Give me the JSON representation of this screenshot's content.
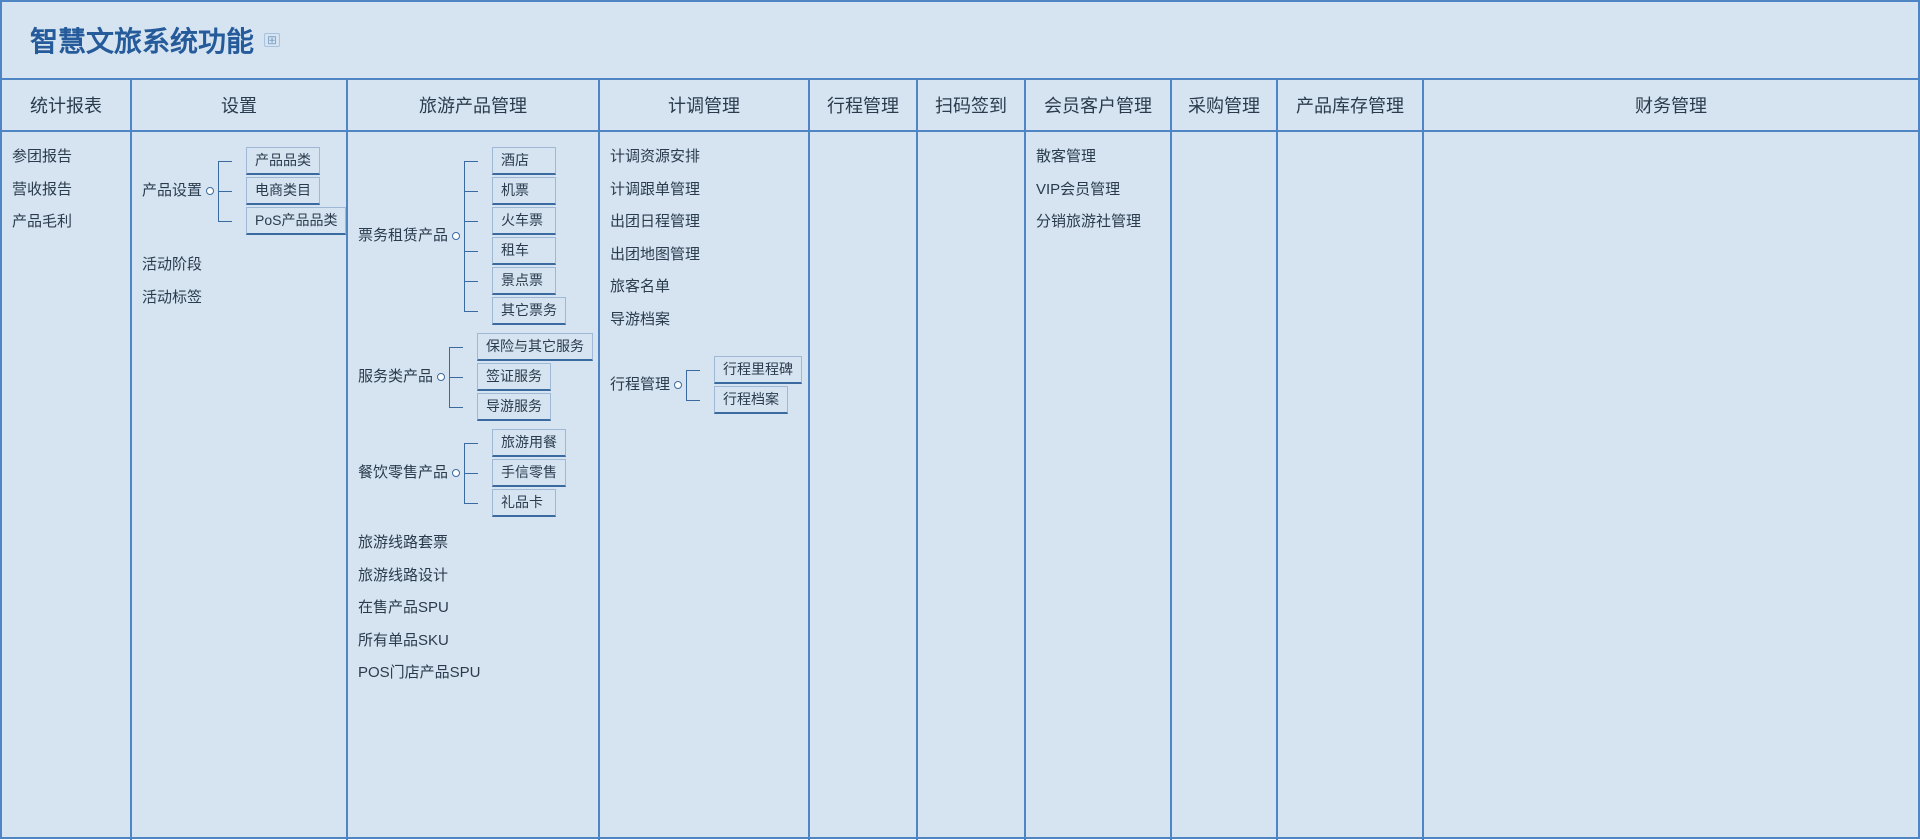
{
  "title": "智慧文旅系统功能",
  "columns": {
    "stats": {
      "header": "统计报表",
      "items": [
        "参团报告",
        "营收报告",
        "产品毛利"
      ]
    },
    "settings": {
      "header": "设置",
      "product_settings_label": "产品设置",
      "product_settings_children": [
        "产品品类",
        "电商类目",
        "PoS产品品类"
      ],
      "extra": [
        "活动阶段",
        "活动标签"
      ]
    },
    "products": {
      "header": "旅游产品管理",
      "groups": [
        {
          "label": "票务租赁产品",
          "children": [
            "酒店",
            "机票",
            "火车票",
            "租车",
            "景点票",
            "其它票务"
          ]
        },
        {
          "label": "服务类产品",
          "children": [
            "保险与其它服务",
            "签证服务",
            "导游服务"
          ]
        },
        {
          "label": "餐饮零售产品",
          "children": [
            "旅游用餐",
            "手信零售",
            "礼品卡"
          ]
        }
      ],
      "flat": [
        "旅游线路套票",
        "旅游线路设计",
        "在售产品SPU",
        "所有单品SKU",
        "POS门店产品SPU"
      ]
    },
    "plan": {
      "header": "计调管理",
      "items": [
        "计调资源安排",
        "计调跟单管理",
        "出团日程管理",
        "出团地图管理",
        "旅客名单",
        "导游档案"
      ],
      "trip_group": {
        "label": "行程管理",
        "children": [
          "行程里程碑",
          "行程档案"
        ]
      }
    },
    "trip": {
      "header": "行程管理"
    },
    "scan": {
      "header": "扫码签到"
    },
    "member": {
      "header": "会员客户管理",
      "items": [
        "散客管理",
        "VIP会员管理",
        "分销旅游社管理"
      ]
    },
    "procure": {
      "header": "采购管理"
    },
    "inventory": {
      "header": "产品库存管理"
    },
    "finance": {
      "header": "财务管理"
    }
  }
}
